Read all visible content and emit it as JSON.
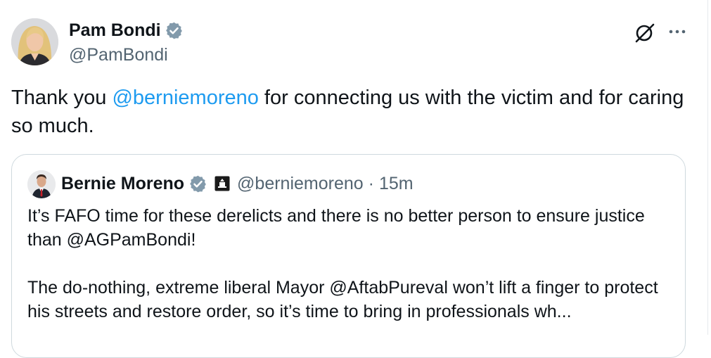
{
  "author": {
    "display_name": "Pam Bondi",
    "handle": "@PamBondi"
  },
  "tweet": {
    "text_before": "Thank you ",
    "mention": "@berniemoreno",
    "text_after": " for connecting us with the victim and for caring so much."
  },
  "quoted": {
    "display_name": "Bernie Moreno",
    "handle": "@berniemoreno",
    "separator": "·",
    "time": "15m",
    "paragraph_1": "It’s FAFO time for these derelicts and there is no better person to ensure justice than @AGPamBondi!",
    "paragraph_2": "The do-nothing, extreme liberal Mayor @AftabPureval won’t lift a finger to protect his streets and restore order, so it’s time to bring in professionals wh..."
  },
  "icons": {
    "verified": "verified-badge-icon",
    "government": "government-building-icon",
    "grok": "grok-icon",
    "more": "more-options-icon"
  },
  "colors": {
    "accent": "#1d9bf0",
    "text": "#0f1419",
    "secondary": "#536471",
    "border": "#cfd9de"
  }
}
